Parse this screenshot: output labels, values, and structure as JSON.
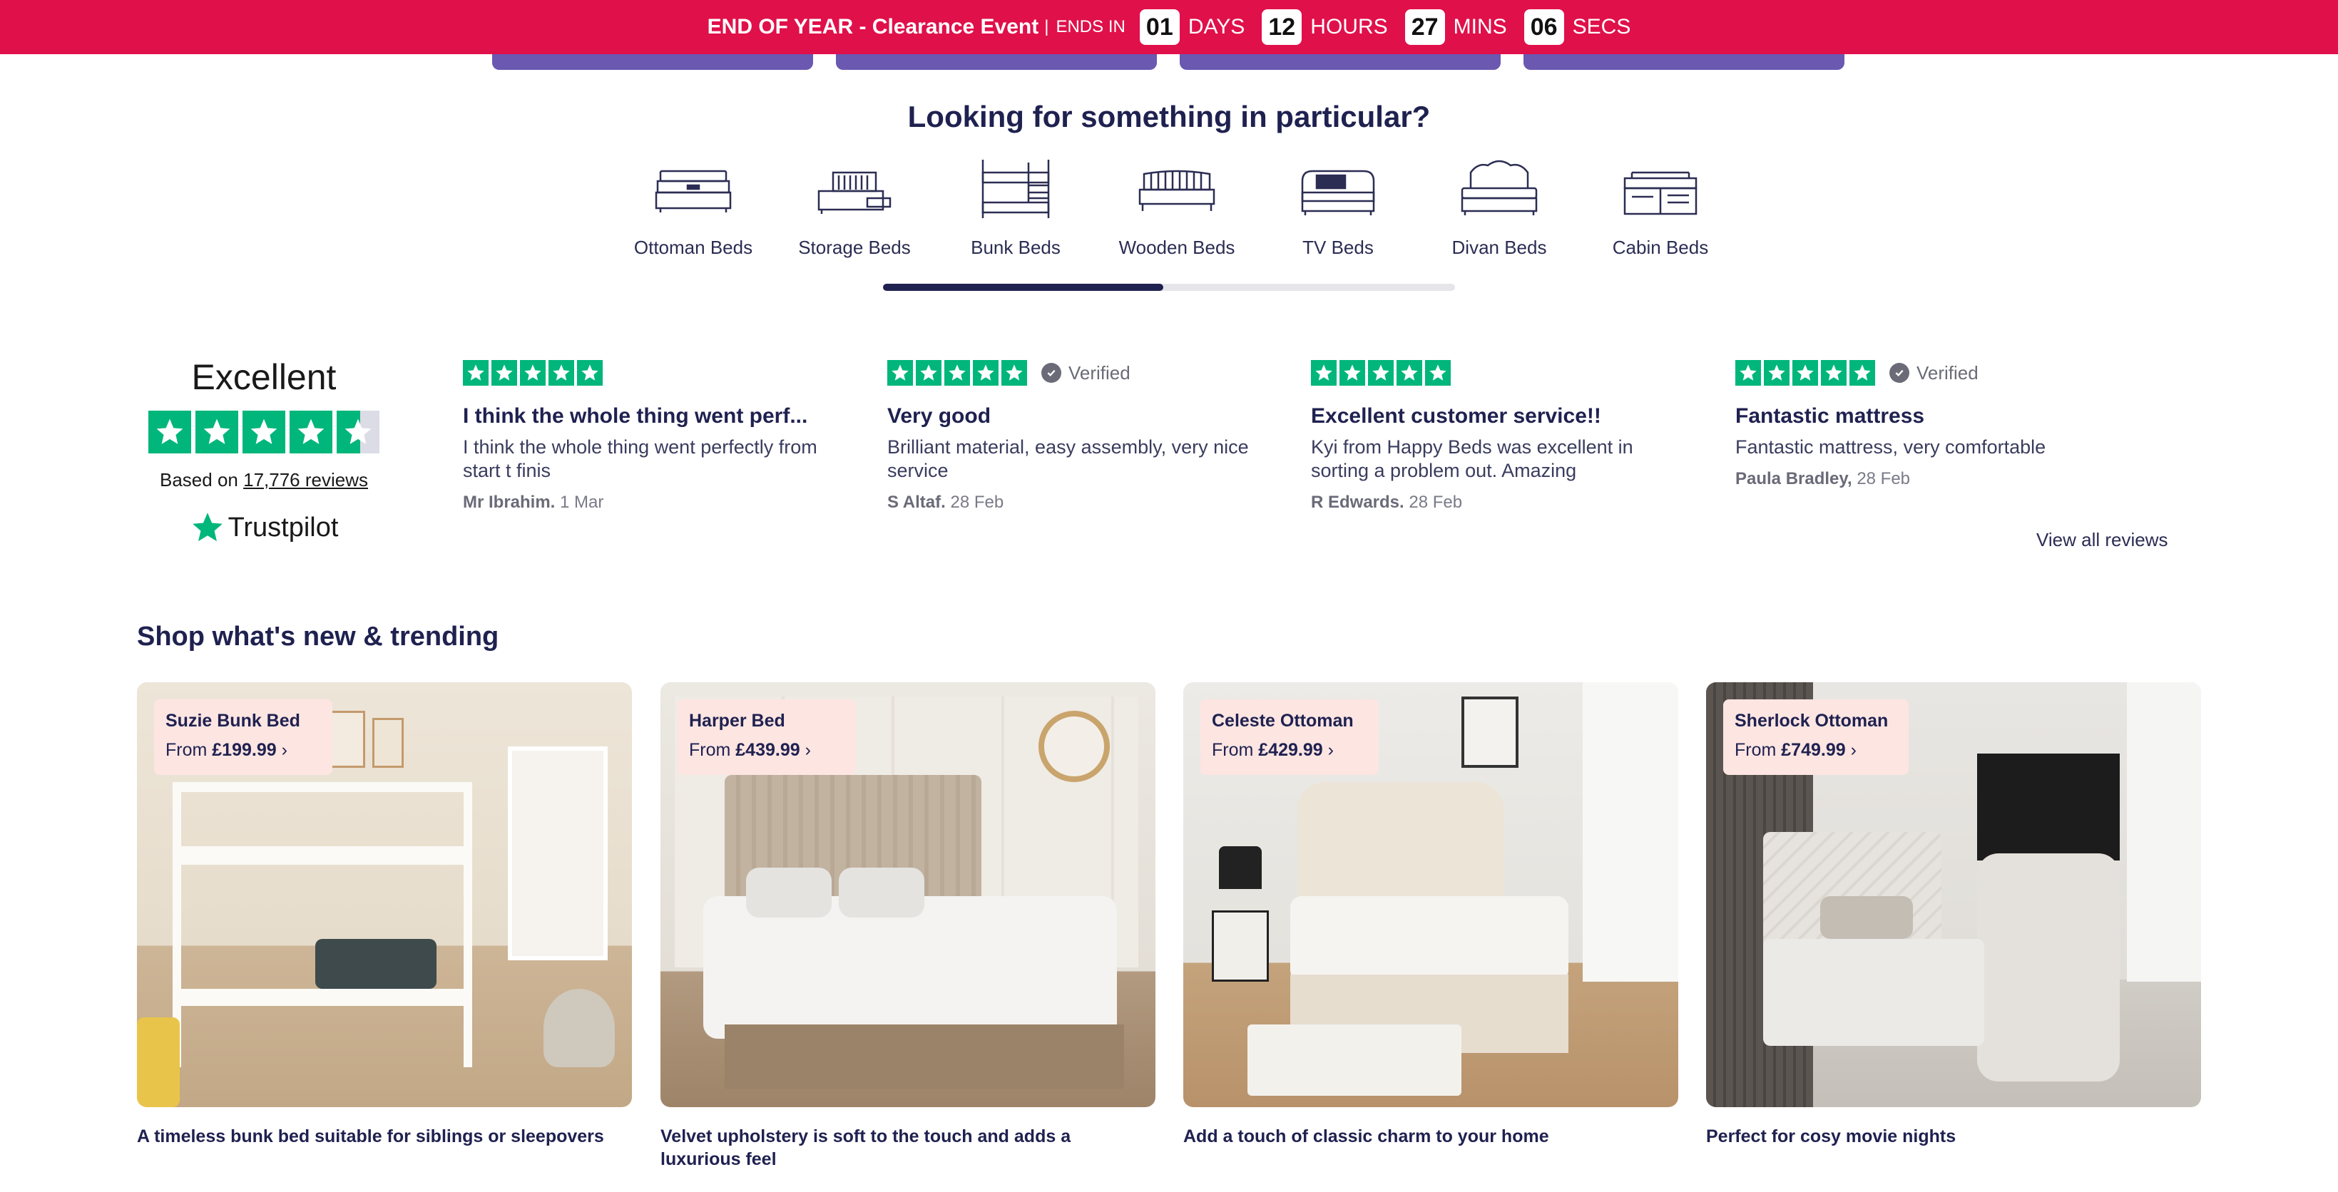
{
  "promo": {
    "headline": "END OF YEAR - Clearance Event",
    "separator": "|",
    "ends_in": "ENDS IN",
    "countdown": [
      {
        "value": "01",
        "unit": "DAYS"
      },
      {
        "value": "12",
        "unit": "HOURS"
      },
      {
        "value": "27",
        "unit": "MINS"
      },
      {
        "value": "06",
        "unit": "SECS"
      }
    ],
    "background_color": "#e0104a"
  },
  "categories": {
    "title": "Looking for something in particular?",
    "items": [
      {
        "label": "Ottoman Beds",
        "icon": "ottoman-bed-icon"
      },
      {
        "label": "Storage Beds",
        "icon": "storage-bed-icon"
      },
      {
        "label": "Bunk Beds",
        "icon": "bunk-bed-icon"
      },
      {
        "label": "Wooden Beds",
        "icon": "wooden-bed-icon"
      },
      {
        "label": "TV Beds",
        "icon": "tv-bed-icon"
      },
      {
        "label": "Divan Beds",
        "icon": "divan-bed-icon"
      },
      {
        "label": "Cabin Beds",
        "icon": "cabin-bed-icon"
      }
    ],
    "scroll_progress": 0.49
  },
  "trustpilot": {
    "rating_text": "Excellent",
    "stars": 4.5,
    "based_on_prefix": "Based on",
    "review_count": "17,776 reviews",
    "brand": "Trustpilot",
    "color": "#00b67a"
  },
  "reviews": [
    {
      "stars": 5,
      "verified": "",
      "title": "I think the whole thing went perf...",
      "body": "I think the whole thing went perfectly from start t finis",
      "author": "Mr Ibrahim.",
      "date": "1 Mar"
    },
    {
      "stars": 5,
      "verified": "Verified",
      "title": "Very good",
      "body": "Brilliant material, easy assembly, very nice service",
      "author": "S Altaf.",
      "date": "28 Feb"
    },
    {
      "stars": 5,
      "verified": "",
      "title": "Excellent customer service!!",
      "body": "Kyi from Happy Beds was excellent in sorting a problem out. Amazing",
      "author": "R Edwards.",
      "date": "28 Feb"
    },
    {
      "stars": 5,
      "verified": "Verified",
      "title": "Fantastic mattress",
      "body": "Fantastic mattress, very comfortable",
      "author": "Paula Bradley,",
      "date": "28 Feb"
    }
  ],
  "view_all_reviews": "View all reviews",
  "trending": {
    "title": "Shop what's new & trending",
    "products": [
      {
        "name": "Suzie Bunk Bed",
        "from": "From",
        "price": "£199.99",
        "caption": "A timeless bunk bed suitable for siblings or sleepovers"
      },
      {
        "name": "Harper Bed",
        "from": "From",
        "price": "£439.99",
        "caption": "Velvet upholstery is soft to the touch and adds a luxurious feel"
      },
      {
        "name": "Celeste Ottoman",
        "from": "From",
        "price": "£429.99",
        "caption": "Add a touch of classic charm to your home"
      },
      {
        "name": "Sherlock Ottoman",
        "from": "From",
        "price": "£749.99",
        "caption": "Perfect for cosy movie nights"
      }
    ]
  }
}
